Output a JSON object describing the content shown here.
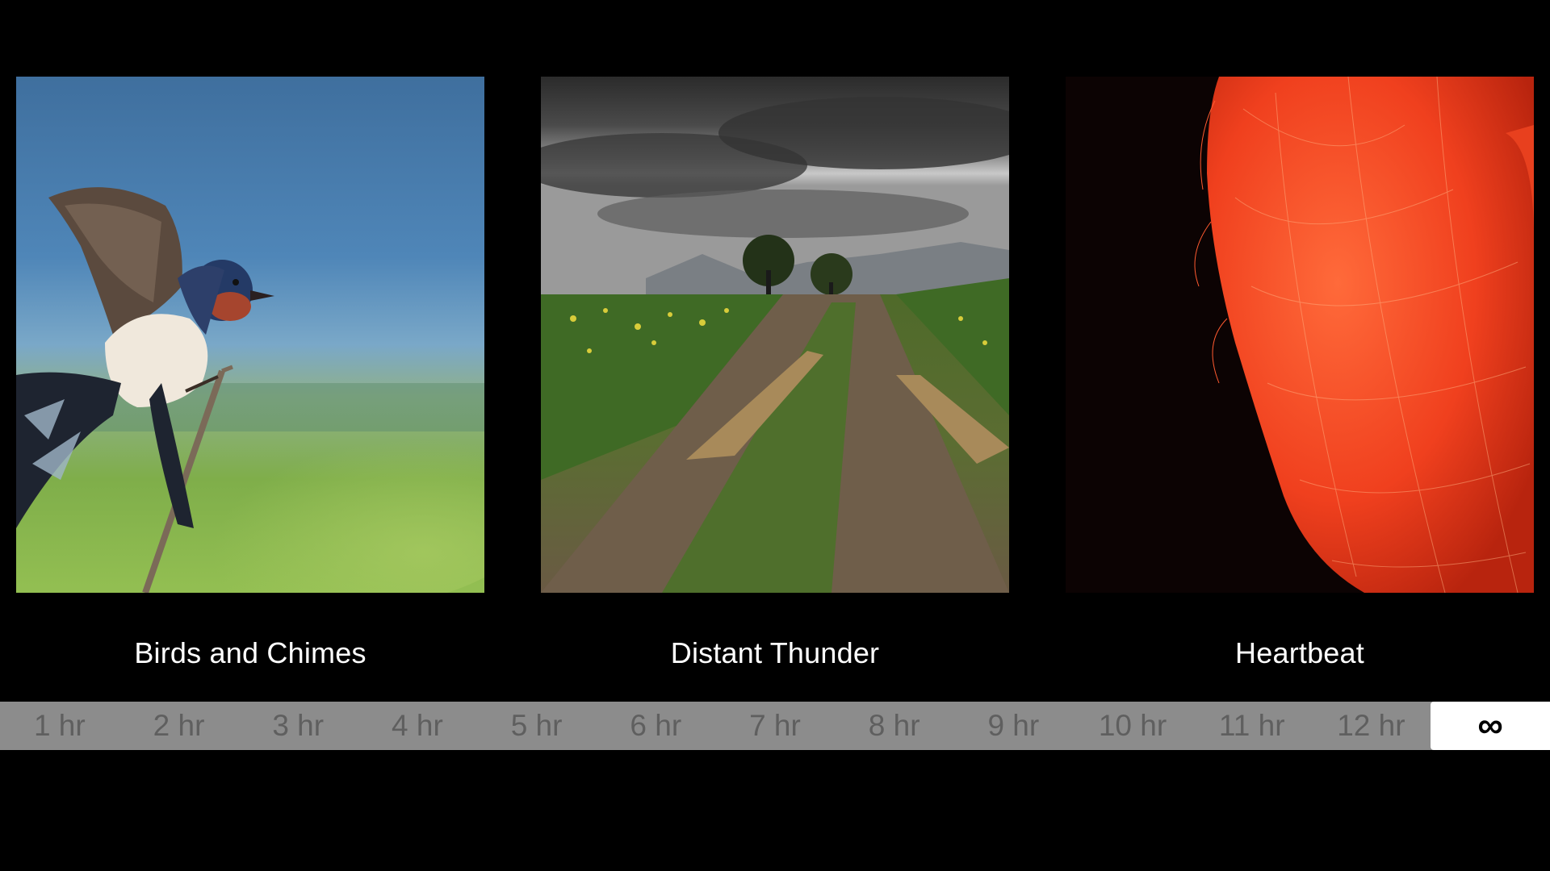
{
  "sounds": [
    {
      "title": "Birds and Chimes",
      "image": "barn swallow perched on a twig against blue sky"
    },
    {
      "title": "Distant Thunder",
      "image": "muddy dirt road through a green field under storm clouds"
    },
    {
      "title": "Heartbeat",
      "image": "red fibrous heart shape on black background"
    }
  ],
  "timer": {
    "options": [
      "1 hr",
      "2 hr",
      "3 hr",
      "4 hr",
      "5 hr",
      "6 hr",
      "7 hr",
      "8 hr",
      "9 hr",
      "10 hr",
      "11 hr",
      "12 hr",
      "∞"
    ],
    "selected_index": 12
  },
  "colors": {
    "background": "#000000",
    "timer_bar": "#8c8c8c",
    "timer_text": "#5f5f5f",
    "selected_bg": "#ffffff"
  }
}
